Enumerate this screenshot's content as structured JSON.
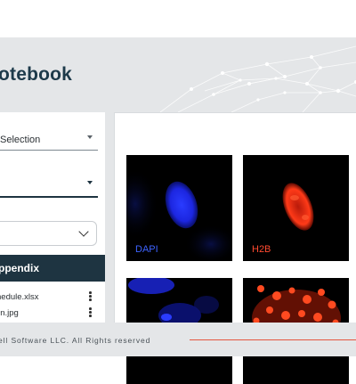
{
  "app": {
    "title": "otebook"
  },
  "sidebar": {
    "selection_label": "Selection",
    "second_field_value": "",
    "dropdown_value": "",
    "section_title": "ppendix",
    "files": [
      {
        "name": "hedule.xlsx"
      },
      {
        "name": "lin.jpg"
      }
    ]
  },
  "images": [
    {
      "label": "DAPI",
      "label_color": "#3d63ff",
      "stain_color": "#1f2fff"
    },
    {
      "label": "H2B",
      "label_color": "#ff4a30",
      "stain_color": "#ff2a10"
    },
    {
      "label": "",
      "stain_color": "#1f2fff"
    },
    {
      "label": "",
      "stain_color": "#ff3a18"
    }
  ],
  "footer": {
    "copyright": "ell Software LLC. All Rights reserved"
  },
  "colors": {
    "brand_dark": "#1e3441",
    "accent_line": "#e4573f",
    "header_bg": "#e4e6e8"
  }
}
